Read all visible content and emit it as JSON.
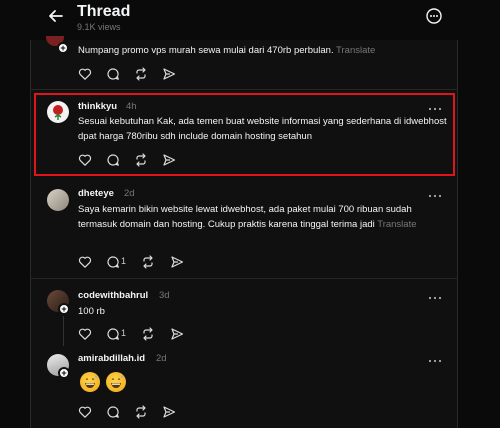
{
  "header": {
    "title": "Thread",
    "views": "9.1K views"
  },
  "translate_label": "Translate",
  "posts": [
    {
      "text": "Numpang promo vps murah sewa mulai dari 470rb perbulan."
    },
    {
      "username": "thinkkyu",
      "time": "4h",
      "text": "Sesuai kebutuhan Kak, ada temen buat website informasi yang sederhana di idwebhost dpat harga 780ribu sdh include domain hosting setahun"
    },
    {
      "username": "dheteye",
      "time": "2d",
      "text": "Saya kemarin bikin website lewat idwebhost, ada paket mulai 700 ribuan sudah termasuk domain dan hosting. Cukup praktis karena tinggal terima jadi",
      "reply_count": "1"
    },
    {
      "username": "codewithbahrul",
      "time": "3d",
      "text": "100 rb",
      "reply_count": "1"
    },
    {
      "username": "amirabdillah.id",
      "time": "2d",
      "text": ""
    }
  ],
  "colors": {
    "background": "#0a0a0a",
    "panel": "#101010",
    "highlight_border": "#e0151b",
    "muted_text": "#777777"
  }
}
